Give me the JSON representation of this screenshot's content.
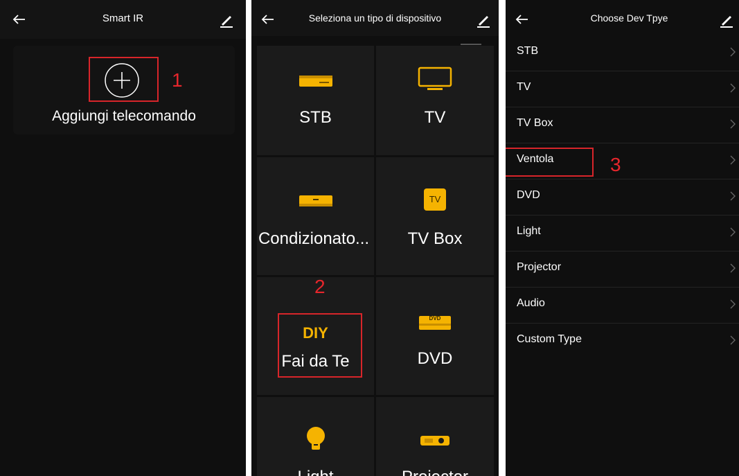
{
  "colors": {
    "background": "#0f0f0f",
    "accent": "#f5b301",
    "annotation": "#d8252a"
  },
  "panel1": {
    "title": "Smart IR",
    "add_label": "Aggiungi telecomando",
    "step": "1"
  },
  "panel2": {
    "title": "Seleziona un tipo di dispositivo",
    "step": "2",
    "cells": [
      {
        "label": "STB",
        "icon": "stb-icon"
      },
      {
        "label": "TV",
        "icon": "tv-icon"
      },
      {
        "label": "Condizionato...",
        "icon": "air-conditioner-icon"
      },
      {
        "label": "TV Box",
        "icon": "tv-box-icon",
        "icon_text": "TV"
      },
      {
        "label": "Fai da Te",
        "label_top": "DIY",
        "icon": "diy-icon"
      },
      {
        "label": "DVD",
        "icon": "dvd-icon",
        "icon_text": "DVD"
      },
      {
        "label": "Light",
        "icon": "light-bulb-icon"
      },
      {
        "label": "Projector",
        "icon": "projector-icon"
      }
    ]
  },
  "panel3": {
    "title": "Choose Dev Tpye",
    "step": "3",
    "items": [
      "STB",
      "TV",
      "TV Box",
      "Ventola",
      "DVD",
      "Light",
      "Projector",
      "Audio",
      "Custom Type"
    ]
  }
}
